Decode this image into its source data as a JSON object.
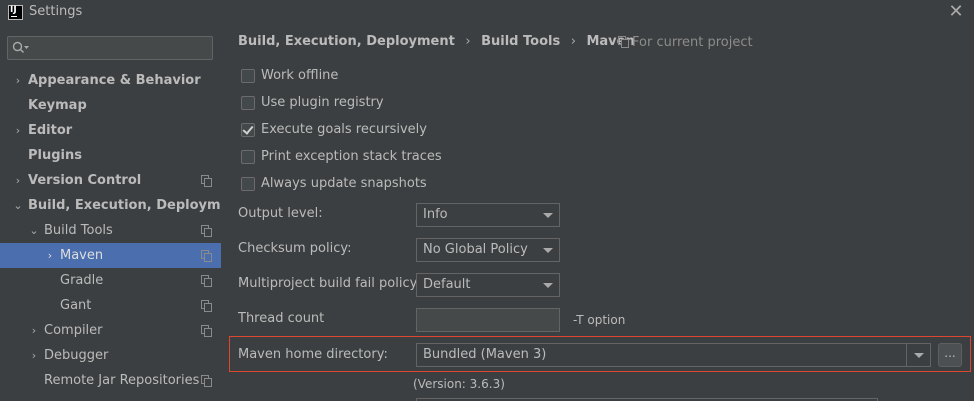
{
  "window": {
    "title": "Settings",
    "close": "✕"
  },
  "sidebar": {
    "search_placeholder": "",
    "items": [
      {
        "label": "Appearance & Behavior",
        "arrow": "›"
      },
      {
        "label": "Keymap",
        "arrow": ""
      },
      {
        "label": "Editor",
        "arrow": "›"
      },
      {
        "label": "Plugins",
        "arrow": ""
      },
      {
        "label": "Version Control",
        "arrow": "›"
      },
      {
        "label": "Build, Execution, Deployment",
        "arrow": "⌄"
      },
      {
        "label": "Build Tools",
        "arrow": "⌄"
      },
      {
        "label": "Maven",
        "arrow": "›"
      },
      {
        "label": "Gradle",
        "arrow": ""
      },
      {
        "label": "Gant",
        "arrow": ""
      },
      {
        "label": "Compiler",
        "arrow": "›"
      },
      {
        "label": "Debugger",
        "arrow": "›"
      },
      {
        "label": "Remote Jar Repositories",
        "arrow": ""
      }
    ]
  },
  "breadcrumb": {
    "items": [
      "Build, Execution, Deployment",
      "Build Tools",
      "Maven"
    ],
    "separator": "›",
    "scope": "For current project"
  },
  "options": {
    "work_offline": {
      "label": "Work offline",
      "checked": false
    },
    "use_plugin_registry": {
      "label": "Use plugin registry",
      "checked": false
    },
    "execute_goals_recursively": {
      "label": "Execute goals recursively",
      "checked": true
    },
    "print_exception_stack_traces": {
      "label": "Print exception stack traces",
      "checked": false
    },
    "always_update_snapshots": {
      "label": "Always update snapshots",
      "checked": false
    }
  },
  "form": {
    "output_level": {
      "label": "Output level:",
      "value": "Info"
    },
    "checksum_policy": {
      "label": "Checksum policy:",
      "value": "No Global Policy"
    },
    "multiproject_fail_policy": {
      "label": "Multiproject build fail policy:",
      "value": "Default"
    },
    "thread_count": {
      "label": "Thread count",
      "value": "",
      "hint": "-T option"
    },
    "maven_home": {
      "label": "Maven home directory:",
      "value": "Bundled (Maven 3)",
      "browse": "...",
      "version": "(Version: 3.6.3)"
    }
  },
  "colors": {
    "background": "#3c3f41",
    "selection": "#4b6eaf",
    "text": "#bbbbbb",
    "highlight_border": "#e0462f"
  },
  "icons": [
    "app-logo-icon",
    "close-icon",
    "search-icon",
    "chevron-right-icon",
    "chevron-down-icon",
    "project-scope-icon",
    "dropdown-arrow-icon"
  ]
}
